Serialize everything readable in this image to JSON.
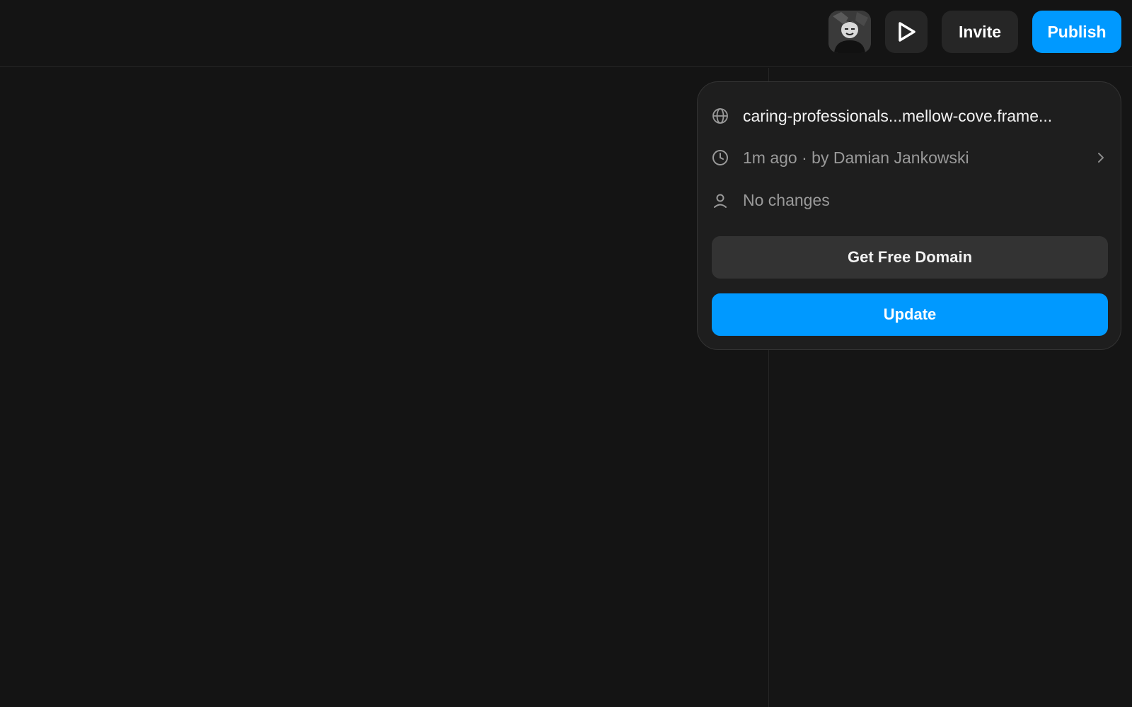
{
  "topbar": {
    "avatar_icon": "user-avatar",
    "play_icon": "play-icon",
    "invite_label": "Invite",
    "publish_label": "Publish"
  },
  "popover": {
    "url": "caring-professionals...mellow-cove.frame...",
    "last_update": "1m ago · by Damian Jankowski",
    "changes": "No changes",
    "domain_button": "Get Free Domain",
    "update_button": "Update"
  },
  "colors": {
    "accent": "#0099ff",
    "background": "#141414",
    "popover_bg": "#1e1e1e",
    "secondary_button": "#333333"
  }
}
